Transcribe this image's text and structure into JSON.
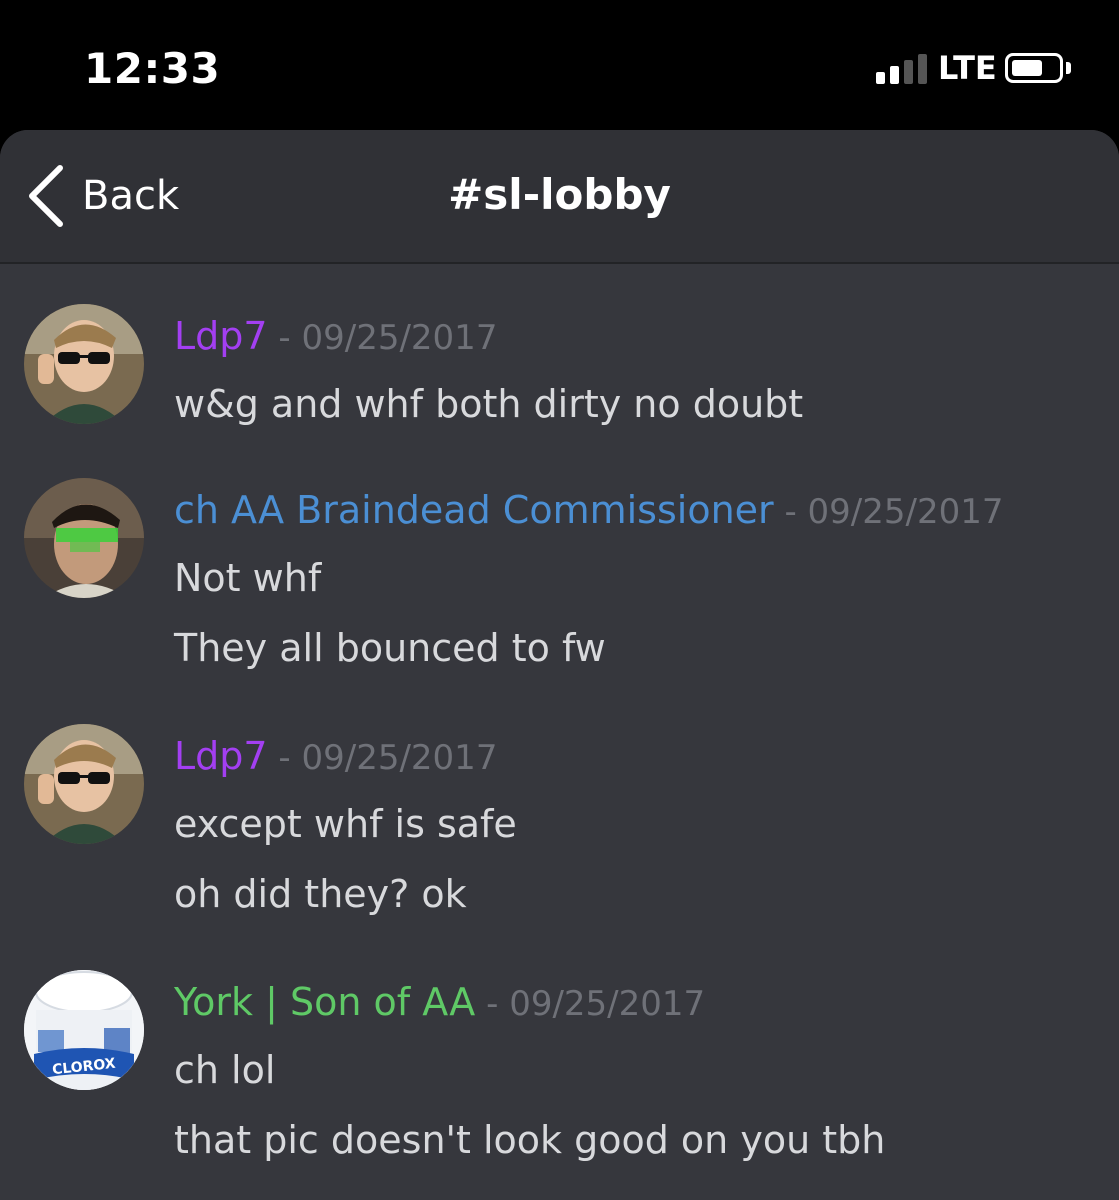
{
  "status_bar": {
    "time": "12:33",
    "network": "LTE",
    "signal_bars_active": 2,
    "signal_bars_total": 4
  },
  "nav": {
    "back_label": "Back",
    "channel_title": "#sl-lobby"
  },
  "colors": {
    "background": "#36373d",
    "nav_background": "#303136",
    "author_purple": "#a33ff2",
    "author_blue": "#4b8fd4",
    "author_green": "#5fc966",
    "timestamp": "#6f7178",
    "message_text": "#d8d9dc"
  },
  "messages": [
    {
      "author": "Ldp7",
      "separator": " - ",
      "timestamp": "09/25/2017",
      "avatar": "sunglasses-avatar",
      "lines": [
        "w&g and whf both dirty no doubt"
      ]
    },
    {
      "author": "ch AA Braindead Commissioner",
      "separator": " - ",
      "timestamp": "09/25/2017",
      "avatar": "green-glasses-avatar",
      "lines": [
        "Not whf",
        "They all bounced to fw"
      ]
    },
    {
      "author": "Ldp7",
      "separator": " - ",
      "timestamp": "09/25/2017",
      "avatar": "sunglasses-avatar",
      "lines": [
        "except whf is safe",
        "oh did they? ok"
      ]
    },
    {
      "author": "York | Son of AA",
      "separator": " - ",
      "timestamp": "09/25/2017",
      "avatar": "clorox-avatar",
      "avatar_logo_text": "CLOROX",
      "lines": [
        "ch lol",
        "that pic doesn't look good on you tbh"
      ]
    }
  ]
}
